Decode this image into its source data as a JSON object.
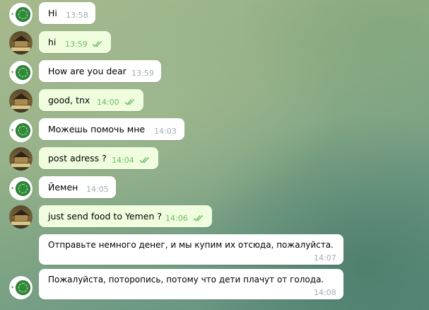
{
  "colors": {
    "incoming_bubble": "#ffffff",
    "outgoing_bubble": "#effdde",
    "incoming_time": "#a0acb6",
    "outgoing_time": "#6cbb5f",
    "read_check": "#6cbb5f"
  },
  "messages": [
    {
      "text": "Hi",
      "time": "13:58",
      "direction": "incoming",
      "avatar": "yemen-avatar",
      "read": false
    },
    {
      "text": "hi",
      "time": "13:59",
      "direction": "outgoing",
      "avatar": "house-avatar",
      "read": true
    },
    {
      "text": "How are you dear",
      "time": "13:59",
      "direction": "incoming",
      "avatar": "yemen-avatar",
      "read": false
    },
    {
      "text": "good, tnx",
      "time": "14:00",
      "direction": "outgoing",
      "avatar": "house-avatar",
      "read": true
    },
    {
      "text": "Можешь помочь мне",
      "time": "14:03",
      "direction": "incoming",
      "avatar": "yemen-avatar",
      "read": false
    },
    {
      "text": "post adress ?",
      "time": "14:04",
      "direction": "outgoing",
      "avatar": "house-avatar",
      "read": true
    },
    {
      "text": "Йемен",
      "time": "14:05",
      "direction": "incoming",
      "avatar": "yemen-avatar",
      "read": false
    },
    {
      "text": "just send food to Yemen ?",
      "time": "14:06",
      "direction": "outgoing",
      "avatar": "house-avatar",
      "read": true
    },
    {
      "text": "Отправьте немного денег, и мы купим их отсюда, пожалуйста.",
      "time": "14:07",
      "direction": "incoming",
      "avatar": "",
      "read": false
    },
    {
      "text": "Пожалуйста, поторопись, потому что дети плачут от голода.",
      "time": "14:08",
      "direction": "incoming",
      "avatar": "yemen-avatar",
      "read": false
    }
  ]
}
